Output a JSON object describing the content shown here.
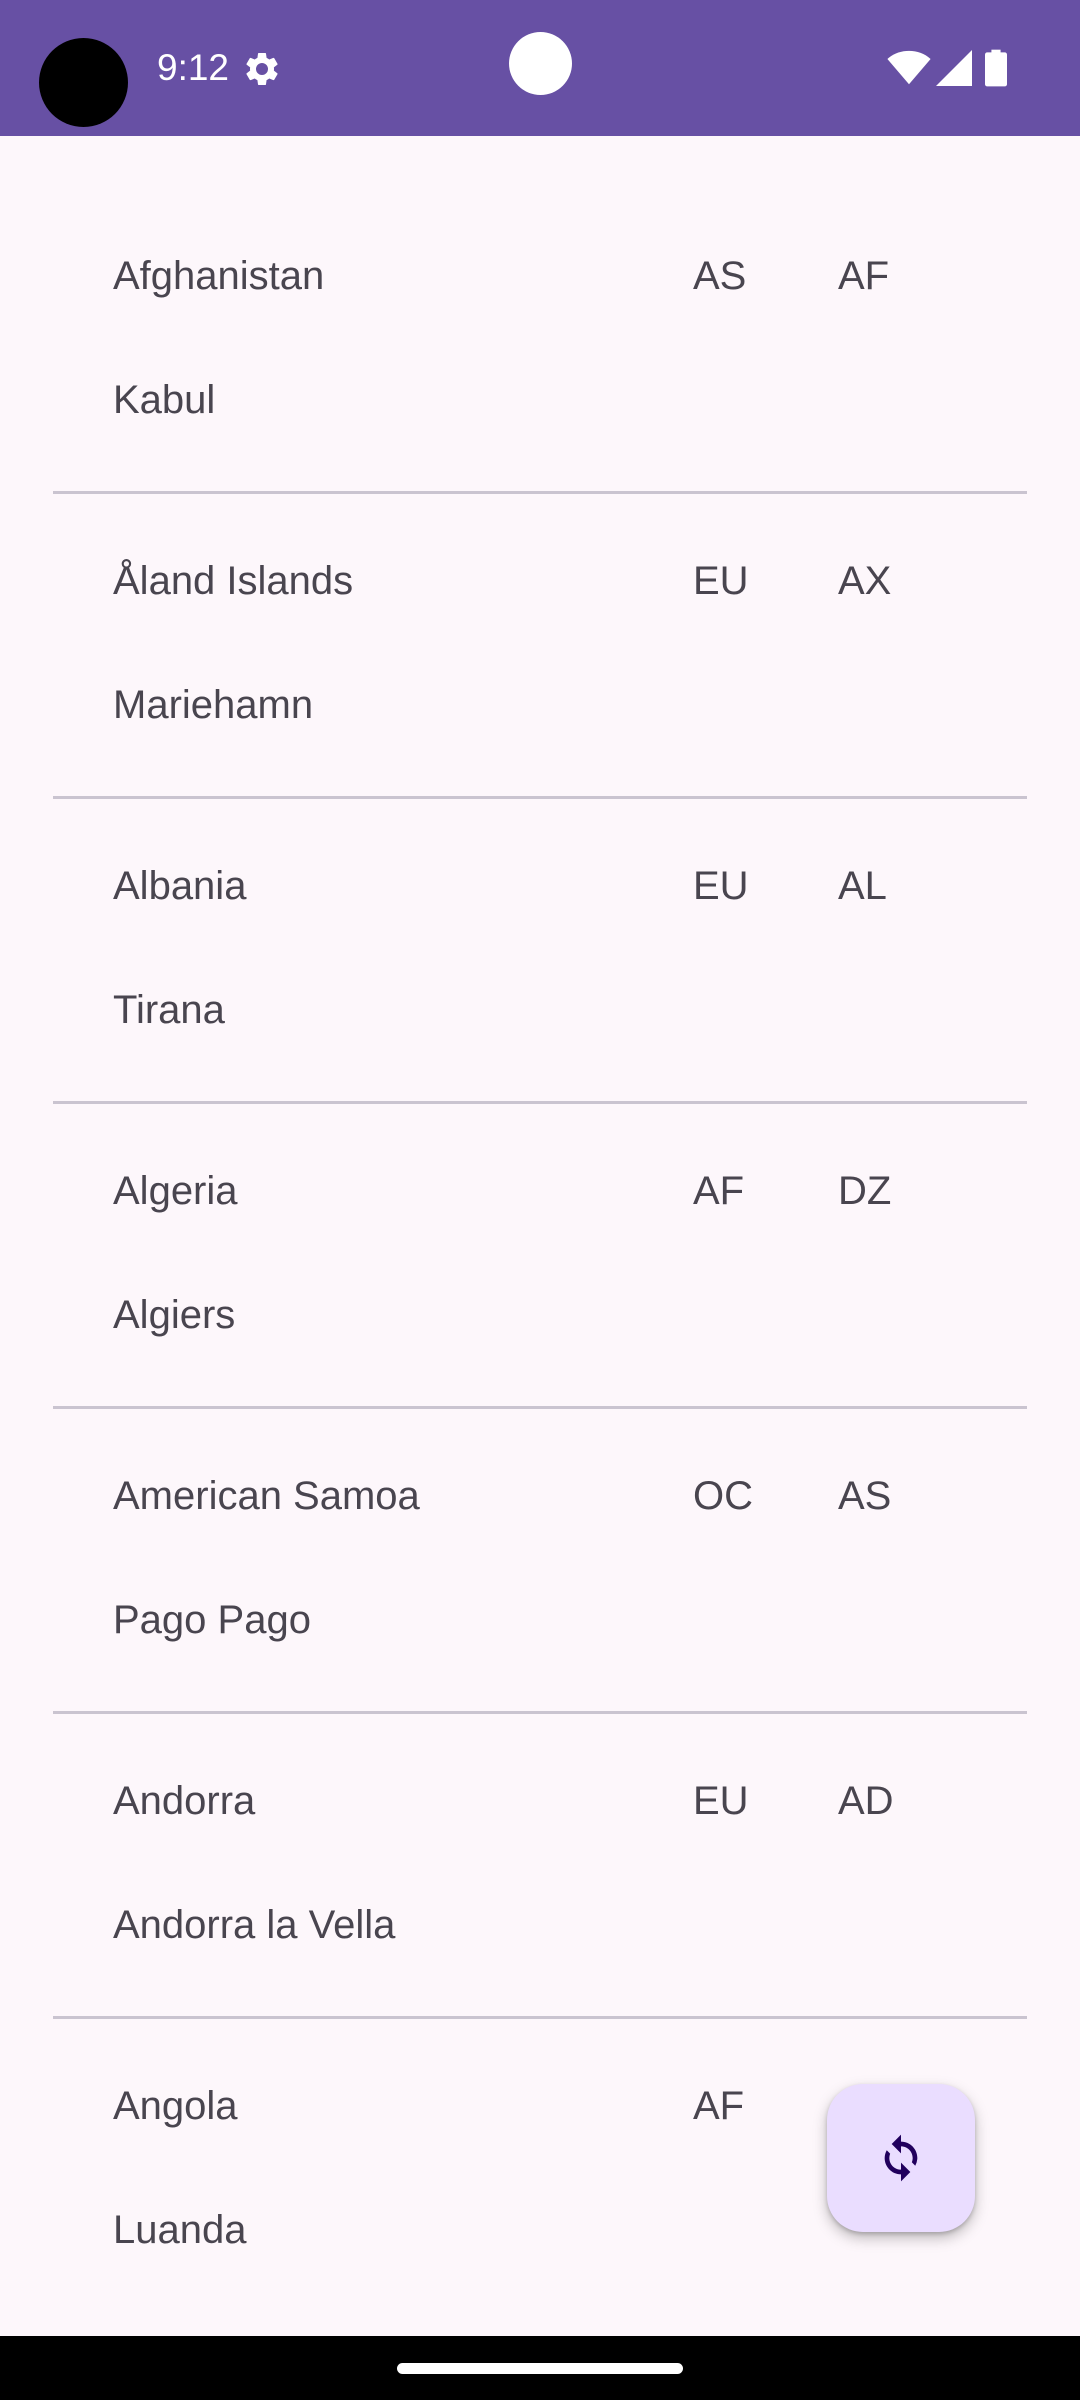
{
  "status_bar": {
    "time": "9:12",
    "icons": [
      "settings-icon",
      "wifi-icon",
      "signal-icon",
      "battery-icon"
    ],
    "background_color": "#6750a4"
  },
  "countries": [
    {
      "name": "Afghanistan",
      "continent": "AS",
      "code": "AF",
      "capital": "Kabul"
    },
    {
      "name": "Åland Islands",
      "continent": "EU",
      "code": "AX",
      "capital": "Mariehamn"
    },
    {
      "name": "Albania",
      "continent": "EU",
      "code": "AL",
      "capital": "Tirana"
    },
    {
      "name": "Algeria",
      "continent": "AF",
      "code": "DZ",
      "capital": "Algiers"
    },
    {
      "name": "American Samoa",
      "continent": "OC",
      "code": "AS",
      "capital": "Pago Pago"
    },
    {
      "name": "Andorra",
      "continent": "EU",
      "code": "AD",
      "capital": "Andorra la Vella"
    },
    {
      "name": "Angola",
      "continent": "AF",
      "code": "",
      "capital": "Luanda"
    }
  ],
  "fab": {
    "icon": "refresh-icon",
    "background_color": "#eaddff"
  }
}
